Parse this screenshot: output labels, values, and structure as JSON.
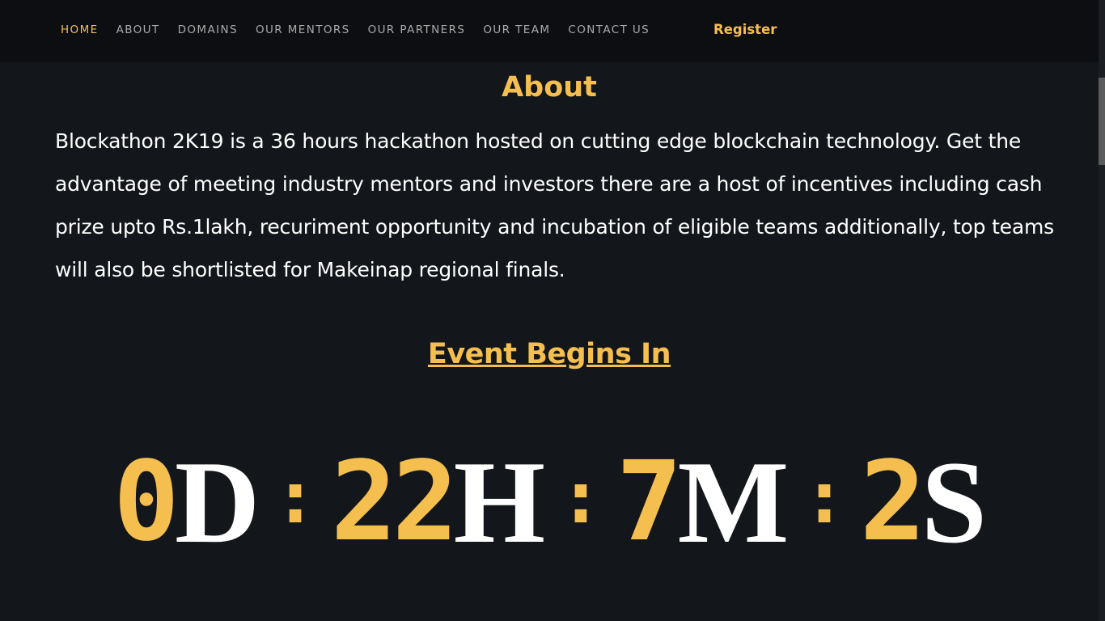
{
  "nav": {
    "items": [
      {
        "label": "HOME",
        "active": true
      },
      {
        "label": "ABOUT",
        "active": false
      },
      {
        "label": "DOMAINS",
        "active": false
      },
      {
        "label": "OUR MENTORS",
        "active": false
      },
      {
        "label": "OUR PARTNERS",
        "active": false
      },
      {
        "label": "OUR TEAM",
        "active": false
      },
      {
        "label": "CONTACT US",
        "active": false
      }
    ],
    "register_label": "Register"
  },
  "about": {
    "title": "About",
    "body": "Blockathon 2K19 is a 36 hours hackathon hosted on cutting edge blockchain technology. Get the advantage of meeting industry mentors and investors there are a host of incentives including cash prize upto Rs.1lakh, recuriment opportunity and incubation of eligible teams additionally, top teams will also be shortlisted for Makeinap regional finals."
  },
  "event": {
    "title": "Event Begins In",
    "countdown": {
      "days": "0",
      "days_suffix": "D",
      "hours": "22",
      "hours_suffix": "H",
      "minutes": "7",
      "minutes_suffix": "M",
      "seconds": "2",
      "seconds_suffix": "S",
      "separator": ":"
    }
  },
  "colors": {
    "accent": "#f5bf4f",
    "background": "#13161a",
    "navbar": "#0c0e11"
  }
}
